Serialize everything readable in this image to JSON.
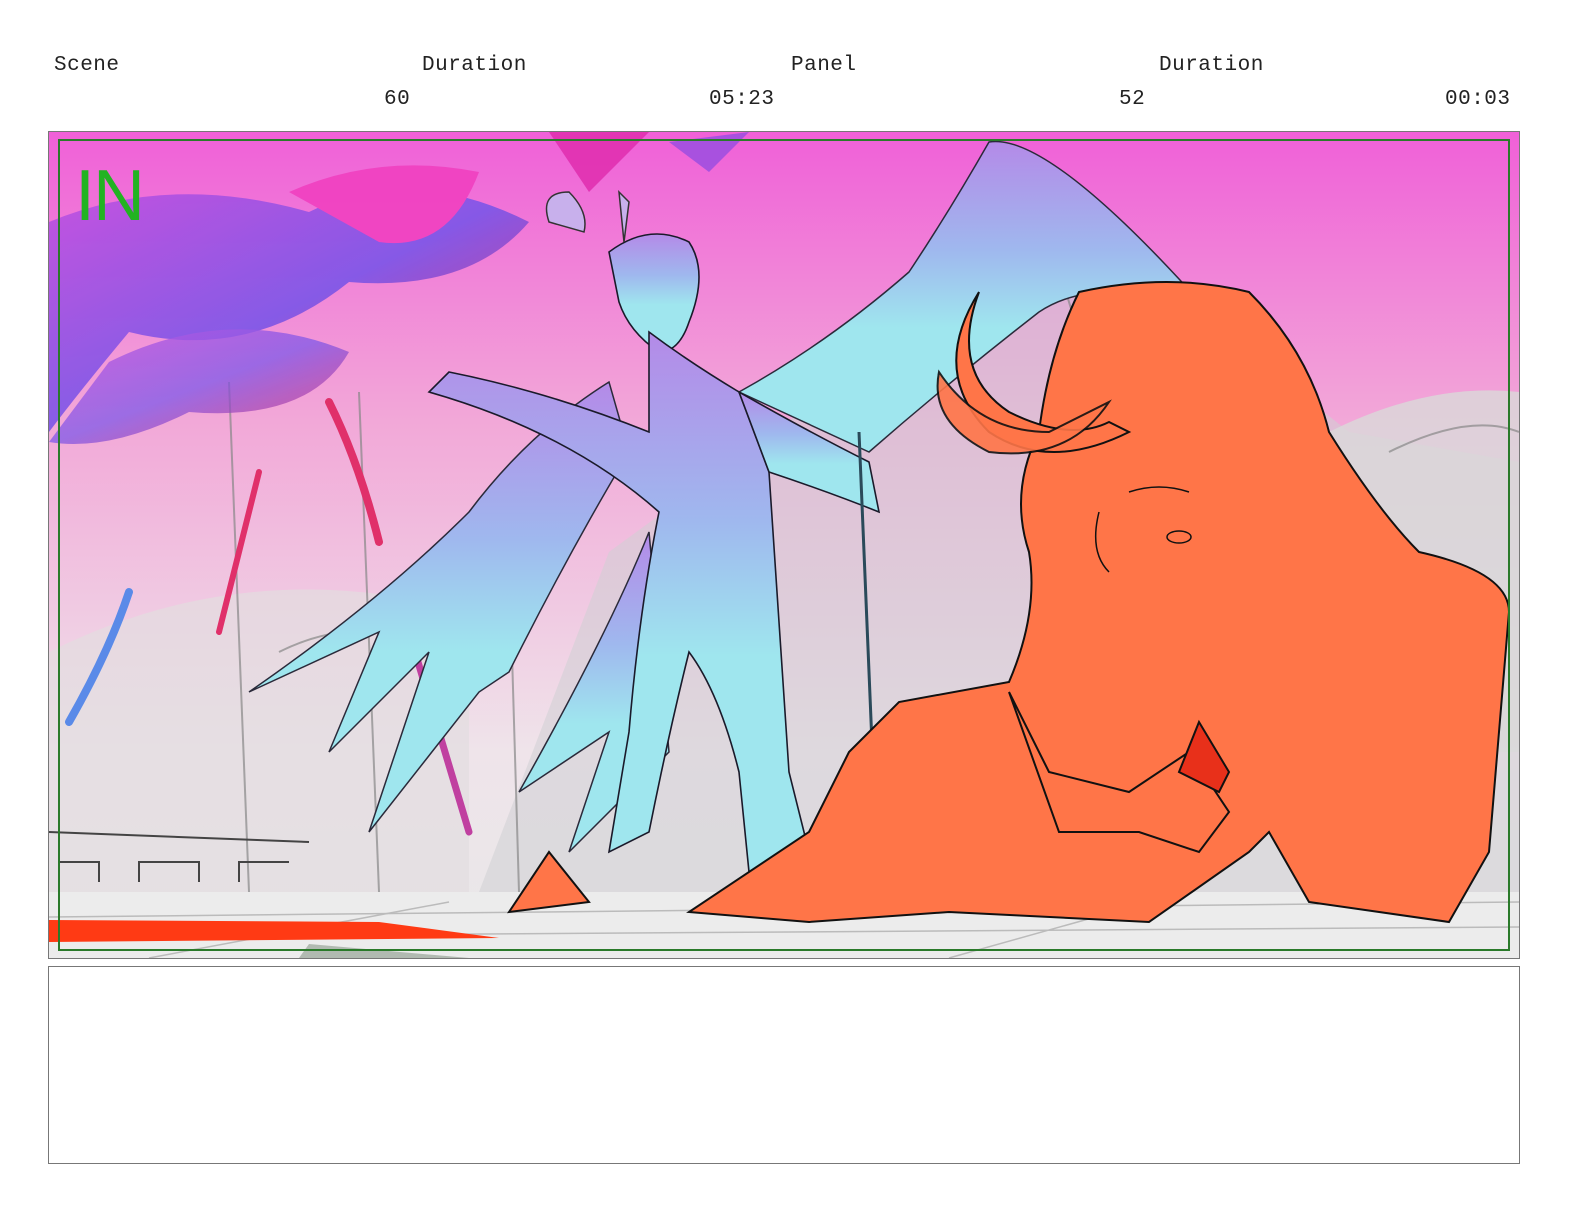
{
  "header": {
    "scene_label": "Scene",
    "scene_duration_label": "Duration",
    "panel_label": "Panel",
    "panel_duration_label": "Duration",
    "scene_number": "60",
    "scene_duration_value": "05:23",
    "panel_number": "52",
    "panel_duration_value": "00:03"
  },
  "panel": {
    "safe_area_label": "IN",
    "label_color": "#22b322",
    "safe_area_color": "#2a7a2a"
  },
  "notes": {
    "text": ""
  },
  "colors": {
    "sky_top": "#f060d8",
    "sky_mid": "#f2a8d8",
    "demon_cyan": "#9fe6ee",
    "demon_orange": "#ff7548",
    "magic_purple": "#7a55e8",
    "floor": "#ececec"
  }
}
